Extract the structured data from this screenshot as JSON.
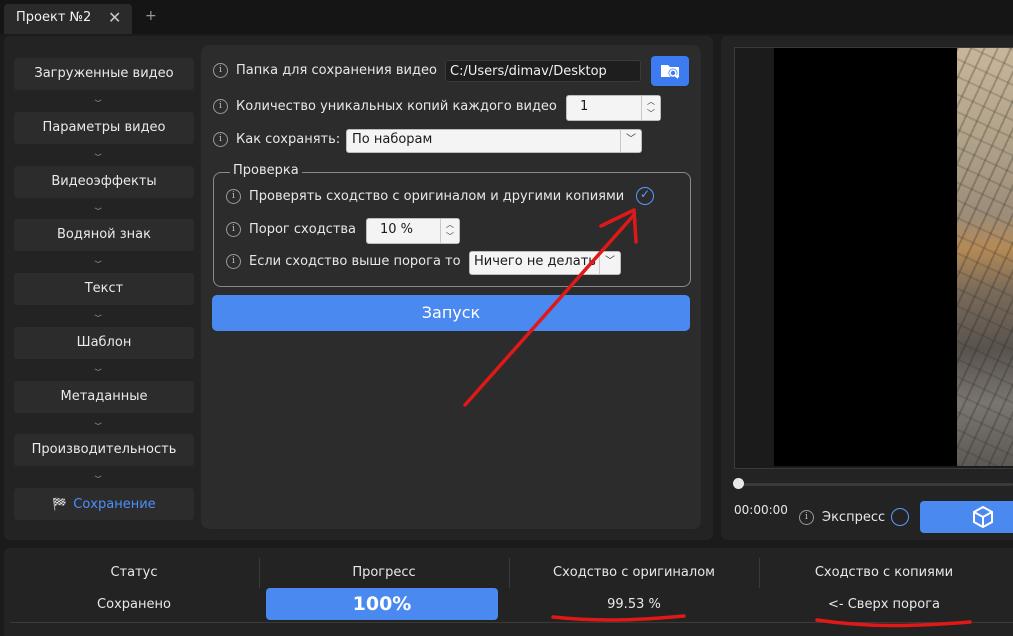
{
  "tab": {
    "title": "Проект №2",
    "close": "✕",
    "add": "+"
  },
  "sidebar": {
    "items": [
      {
        "label": "Загруженные видео"
      },
      {
        "label": "Параметры видео"
      },
      {
        "label": "Видеоэффекты"
      },
      {
        "label": "Водяной знак"
      },
      {
        "label": "Текст"
      },
      {
        "label": "Шаблон"
      },
      {
        "label": "Метаданные"
      },
      {
        "label": "Производительность"
      },
      {
        "label": "Сохранение",
        "active": true
      }
    ]
  },
  "settings": {
    "folder_label": "Папка для сохранения видео",
    "folder_value": "C:/Users/dimav/Desktop",
    "copies_label": "Количество уникальных копий каждого видео",
    "copies_value": "1",
    "save_mode_label": "Как сохранять:",
    "save_mode_value": "По наборам",
    "check_group_title": "Проверка",
    "check_similarity_label": "Проверять сходство с оригиналом и другими копиями",
    "check_similarity_checked": true,
    "threshold_label": "Порог сходства",
    "threshold_value": "10 %",
    "action_label": "Если сходство выше порога то",
    "action_value": "Ничего не делать",
    "start_label": "Запуск"
  },
  "player": {
    "time": "00:00:00",
    "express_label": "Экспресс",
    "seek_fraction": 0
  },
  "status": {
    "headers": [
      "Статус",
      "Прогресс",
      "Сходство с оригиналом",
      "Сходство с копиями"
    ],
    "status_value": "Сохранено",
    "progress_value": "100%",
    "progress_fraction": 1.0,
    "similarity_original": "99.53 %",
    "similarity_copies": "<- Сверх порога"
  },
  "colors": {
    "accent": "#4a8af0",
    "annotation": "#e01818",
    "background": "#1b1b1b",
    "panel": "#232323"
  }
}
